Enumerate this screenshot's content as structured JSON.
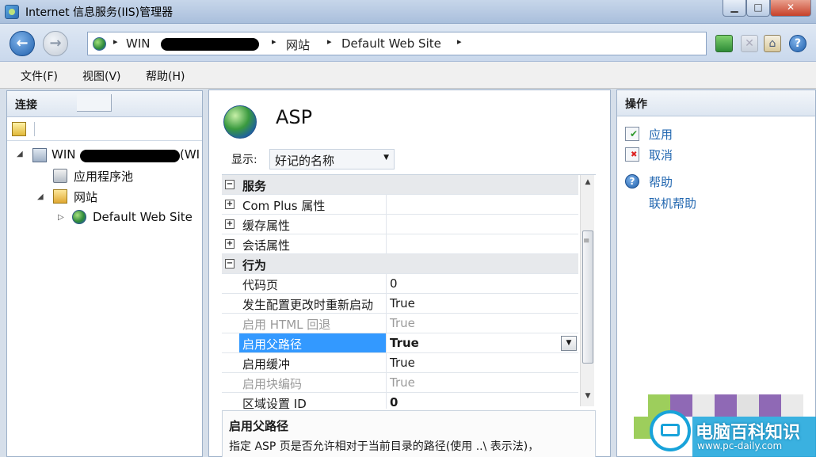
{
  "window": {
    "title": "Internet 信息服务(IIS)管理器",
    "controls": {
      "minimize": "▁",
      "maximize": "□",
      "close": "✕"
    }
  },
  "address_bar": {
    "crumbs": [
      "WIN",
      "网站",
      "Default Web Site"
    ],
    "arrow": "▸"
  },
  "menu": [
    "文件(F)",
    "视图(V)",
    "帮助(H)"
  ],
  "connections": {
    "title": "连接",
    "tree": [
      {
        "label": "WIN",
        "suffix": "(WI",
        "icon": "server-icon"
      },
      {
        "label": "应用程序池",
        "icon": "app-pool-icon"
      },
      {
        "label": "网站",
        "icon": "sites-folder-icon"
      },
      {
        "label": "Default Web Site",
        "icon": "globe-icon"
      }
    ]
  },
  "feature": {
    "title": "ASP",
    "display_label": "显示:",
    "display_value": "好记的名称",
    "grid": [
      {
        "type": "group",
        "expander": "⊟",
        "name": "服务",
        "value": ""
      },
      {
        "type": "sub",
        "expander": "⊞",
        "name": "Com Plus 属性",
        "value": ""
      },
      {
        "type": "sub",
        "expander": "⊞",
        "name": "缓存属性",
        "value": ""
      },
      {
        "type": "sub",
        "expander": "⊞",
        "name": "会话属性",
        "value": ""
      },
      {
        "type": "group",
        "expander": "⊟",
        "name": "行为",
        "value": ""
      },
      {
        "type": "prop",
        "name": "代码页",
        "value": "0"
      },
      {
        "type": "prop",
        "name": "发生配置更改时重新启动",
        "value": "True"
      },
      {
        "type": "disabled",
        "name": "启用 HTML 回退",
        "value": "True"
      },
      {
        "type": "selected",
        "name": "启用父路径",
        "value": "True"
      },
      {
        "type": "prop",
        "name": "启用缓冲",
        "value": "True"
      },
      {
        "type": "disabled",
        "name": "启用块编码",
        "value": "True"
      },
      {
        "type": "prop",
        "name": "区域设置 ID",
        "value": "0"
      }
    ],
    "description": {
      "title": "启用父路径",
      "text": "指定 ASP 页是否允许相对于当前目录的路径(使用 ..\\ 表示法)，"
    }
  },
  "actions": {
    "title": "操作",
    "items": [
      {
        "label": "应用",
        "icon": "apply-icon"
      },
      {
        "label": "取消",
        "icon": "cancel-icon"
      },
      {
        "label": "帮助",
        "icon": "help-icon"
      },
      {
        "label": "联机帮助",
        "icon": ""
      }
    ]
  },
  "watermark": {
    "brand": "电脑百科知识",
    "url": "www.pc-daily.com",
    "colors": {
      "blue": "#18a3da",
      "green": "#8cc63f",
      "purple": "#7b4fa8"
    }
  }
}
